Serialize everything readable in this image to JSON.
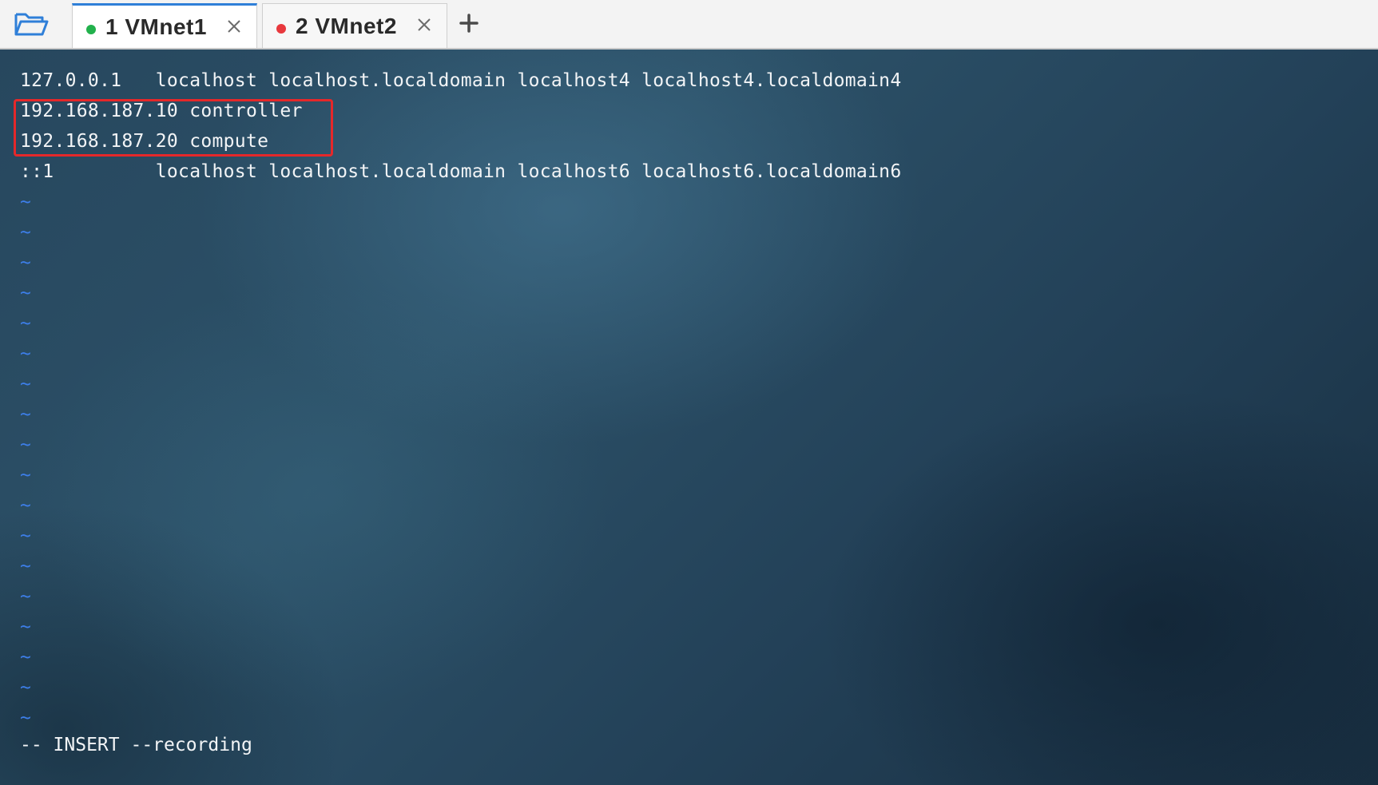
{
  "tabs": [
    {
      "number": "1",
      "name": "VMnet1",
      "label": "1 VMnet1",
      "status_color": "#22b14c",
      "active": true
    },
    {
      "number": "2",
      "name": "VMnet2",
      "label": "2 VMnet2",
      "status_color": "#e8383d",
      "active": false
    }
  ],
  "icons": {
    "open_session": "folder-open-icon",
    "close_tab": "close-icon",
    "new_tab": "plus-icon"
  },
  "terminal": {
    "lines": [
      "127.0.0.1   localhost localhost.localdomain localhost4 localhost4.localdomain4",
      "192.168.187.10 controller",
      "192.168.187.20 compute",
      "::1         localhost localhost.localdomain localhost6 localhost6.localdomain6"
    ],
    "empty_line_marker": "~",
    "status": "-- INSERT --recording"
  },
  "colors": {
    "highlight_box": "#e5282a",
    "tilde": "#3d7ee8",
    "active_tab_accent": "#2f7fd8",
    "terminal_text": "#f2f4f6"
  }
}
